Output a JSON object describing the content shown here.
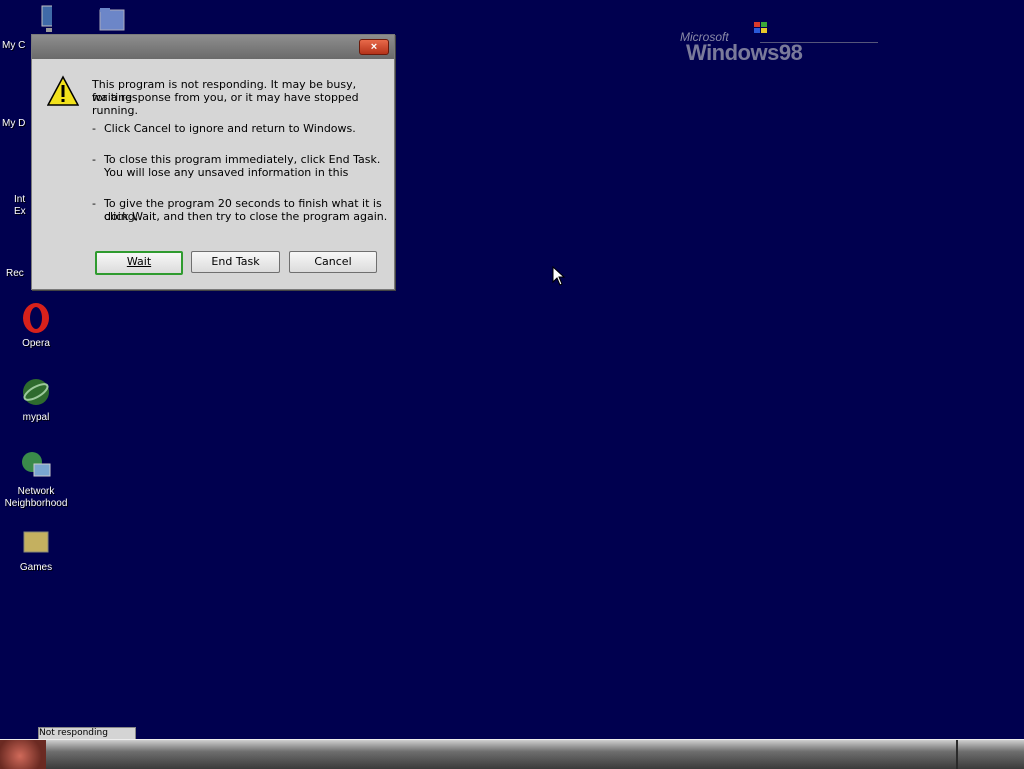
{
  "desktop": {
    "icons": [
      {
        "label": "My C",
        "icon": "my-computer-icon"
      },
      {
        "label": "",
        "icon": "folder-icon"
      },
      {
        "label": "My D",
        "icon": "my-documents-icon"
      },
      {
        "label": "Int\nEx",
        "icon": "internet-explorer-icon"
      },
      {
        "label": "Rec",
        "icon": "recycle-bin-icon"
      },
      {
        "label": "Opera",
        "icon": "opera-icon"
      },
      {
        "label": "mypal",
        "icon": "mypal-icon"
      },
      {
        "label": "Network\nNeighborhood",
        "icon": "network-neighborhood-icon"
      },
      {
        "label": "Games",
        "icon": "games-folder-icon"
      }
    ],
    "background_color": "#00004f"
  },
  "logo": {
    "company": "Microsoft",
    "product": "Windows98"
  },
  "dialog": {
    "close_glyph": "×",
    "icon": "warning-icon",
    "message_line1": "This program is not responding. It may be busy, waiting",
    "message_line2": "for a response from you, or it may have stopped running.",
    "item1": "Click Cancel to ignore and return to Windows.",
    "item2_line1": "To close this program immediately, click End Task.",
    "item2_line2": "You will lose any unsaved information in this",
    "item3_line1": "To give the program 20 seconds to finish what it is doing,",
    "item3_line2": "click Wait, and then try to close the program again.",
    "dash": "-",
    "buttons": {
      "wait": "Wait",
      "end_task": "End Task",
      "cancel": "Cancel"
    },
    "default_button_color": "#2f9b2f"
  },
  "taskbar": {
    "tooltip_text": "Not responding"
  }
}
